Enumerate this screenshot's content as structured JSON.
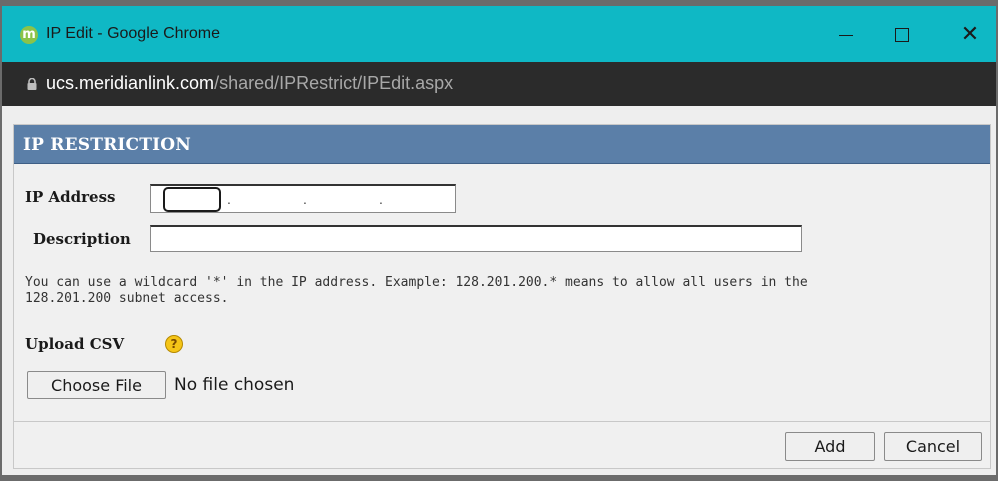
{
  "window": {
    "title": "IP Edit - Google Chrome",
    "app_icon_letter": "m",
    "controls": {
      "minimize": "—",
      "maximize": "☐",
      "close": "✕"
    }
  },
  "address_bar": {
    "domain": "ucs.meridianlink.com",
    "path": "/shared/IPRestrict/IPEdit.aspx"
  },
  "panel": {
    "title": "IP RESTRICTION",
    "ip_label": "IP Address",
    "ip_segments": [
      "",
      "",
      "",
      ""
    ],
    "ip_separator": ".",
    "description_label": "Description",
    "description_value": "",
    "hint_line1": "You can use a wildcard '*' in the IP address. Example: 128.201.200.* means to allow all users in the",
    "hint_line2": "128.201.200 subnet access.",
    "upload_label": "Upload CSV",
    "help_icon": "?",
    "choose_file_label": "Choose File",
    "no_file_text": "No file chosen",
    "add_label": "Add",
    "cancel_label": "Cancel"
  },
  "colors": {
    "titlebar": "#0fb8c5",
    "panel_header": "#5b7fa8",
    "help_icon": "#f5c518"
  }
}
